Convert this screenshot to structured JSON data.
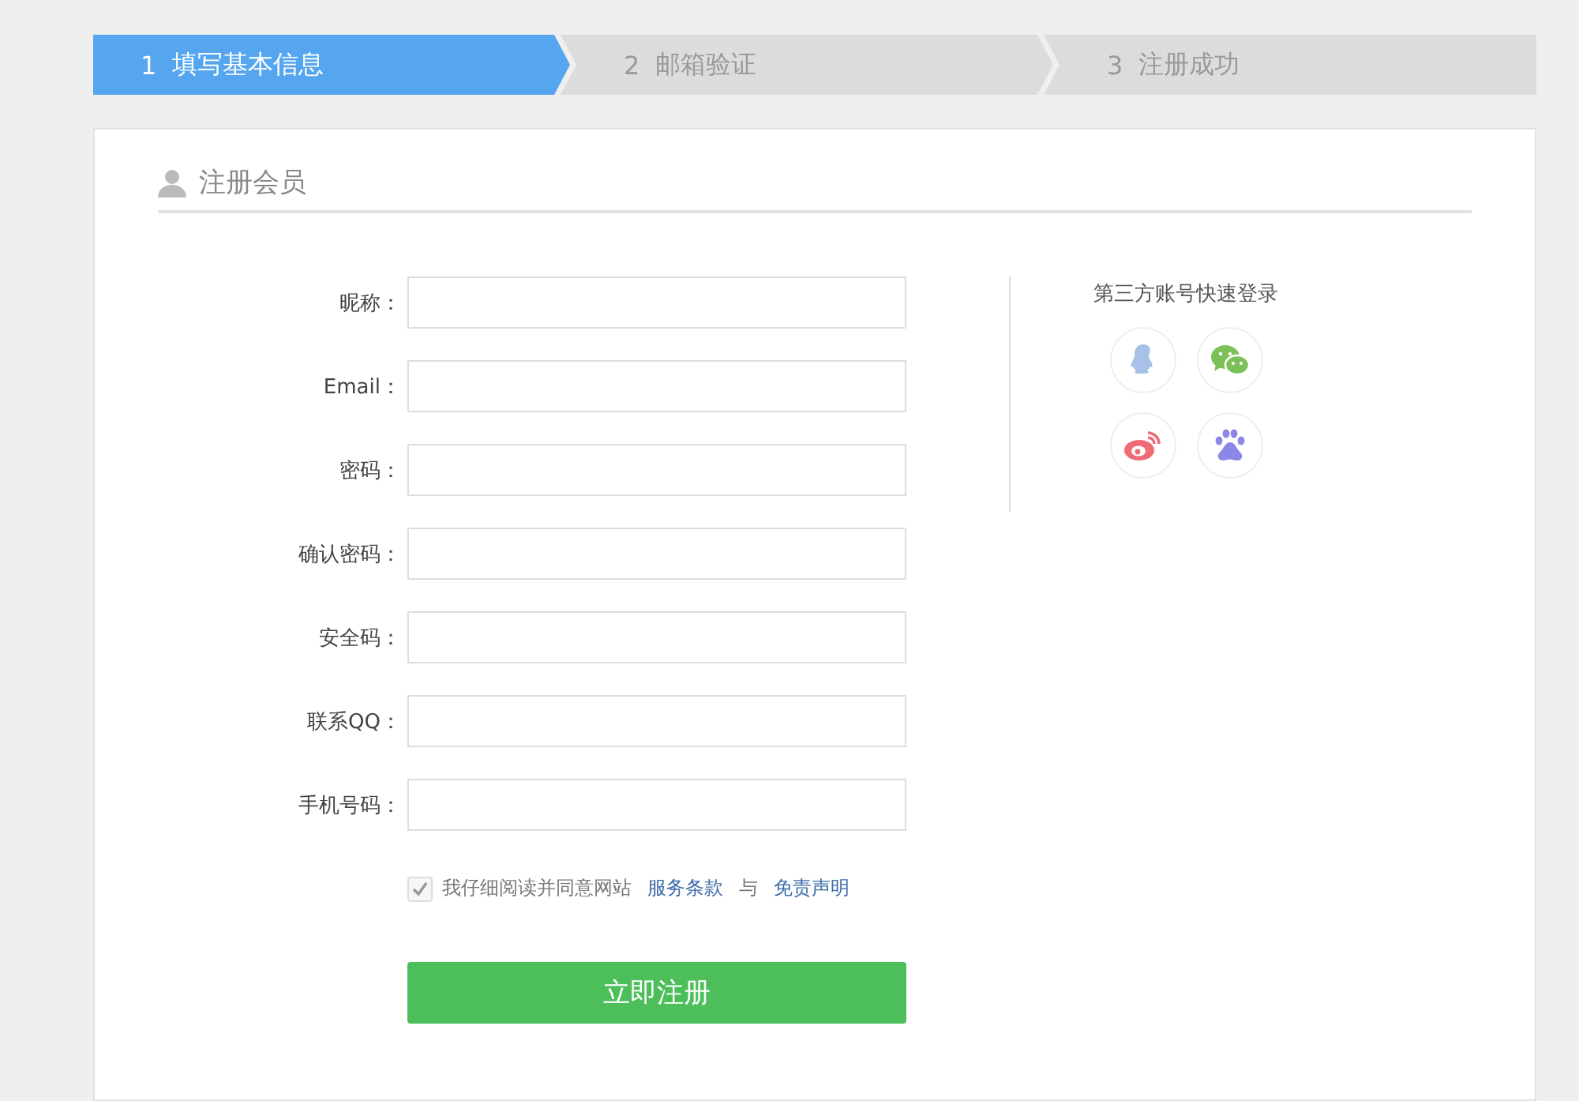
{
  "steps": [
    {
      "number": "1",
      "label": "填写基本信息",
      "selected": true
    },
    {
      "number": "2",
      "label": "邮箱验证",
      "selected": false
    },
    {
      "number": "3",
      "label": "注册成功",
      "selected": false
    }
  ],
  "section_title": "注册会员",
  "fields": [
    {
      "label": "昵称："
    },
    {
      "label": "Email："
    },
    {
      "label": "密码："
    },
    {
      "label": "确认密码："
    },
    {
      "label": "安全码："
    },
    {
      "label": "联系QQ："
    },
    {
      "label": "手机号码："
    }
  ],
  "agreement": {
    "checked": true,
    "text": "我仔细阅读并同意网站",
    "link_1": "服务条款",
    "joiner": "与",
    "link_2": "免责声明"
  },
  "submit": "立即注册",
  "third_party": {
    "title": "第三方账号快速登录",
    "providers": [
      {
        "kind": "qq"
      },
      {
        "kind": "wechat"
      },
      {
        "kind": "weibo"
      },
      {
        "kind": "baidu"
      }
    ]
  }
}
